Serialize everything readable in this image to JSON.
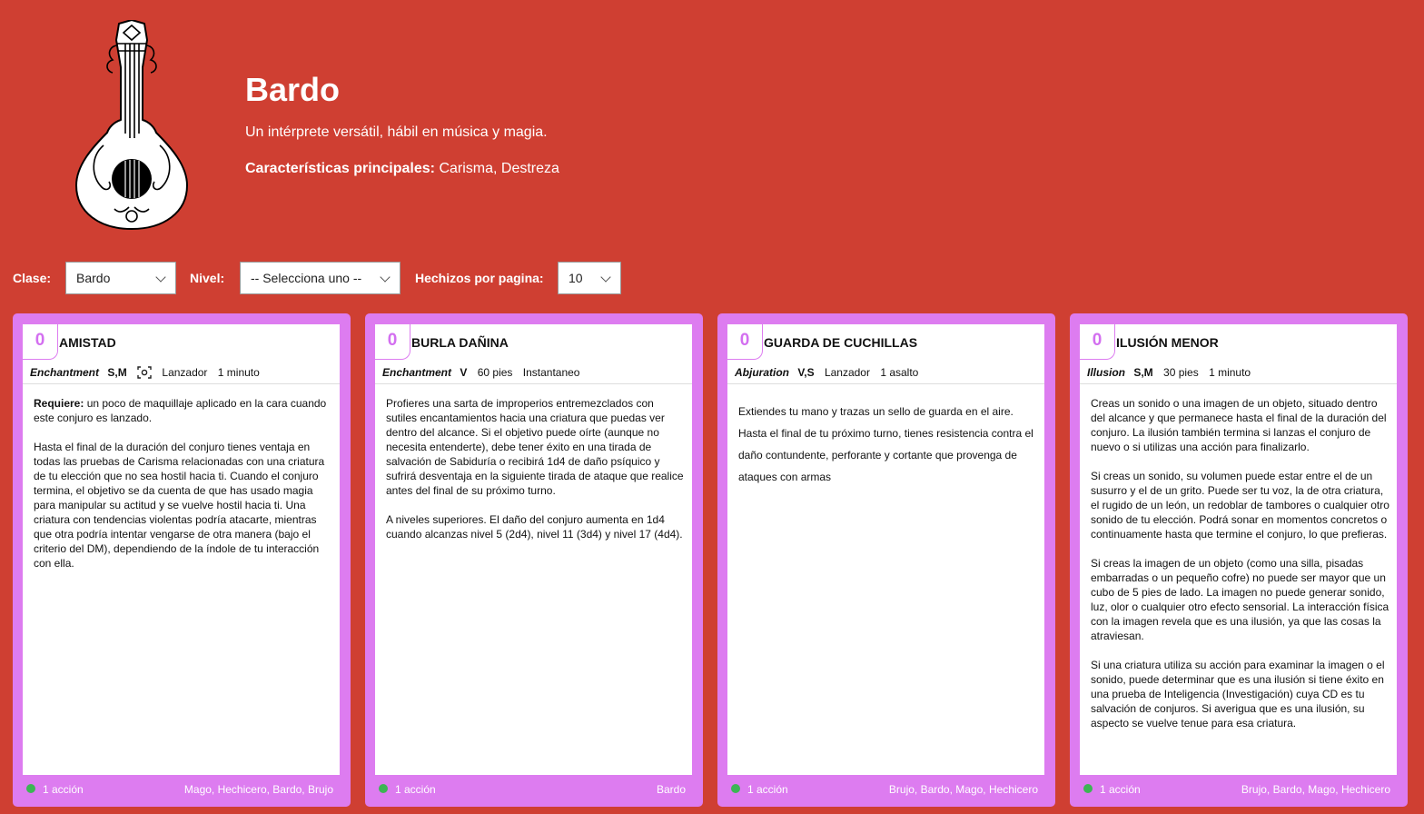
{
  "header": {
    "title": "Bardo",
    "description": "Un intérprete versátil, hábil en música y magia.",
    "main_label": "Características principales:",
    "main_value": "Carisma, Destreza"
  },
  "filters": {
    "class_label": "Clase:",
    "class_value": "Bardo",
    "level_label": "Nivel:",
    "level_value": "-- Selecciona uno --",
    "perpage_label": "Hechizos por pagina:",
    "perpage_value": "10"
  },
  "colors": {
    "background": "#cf3f32",
    "card": "#dd7cf0",
    "level": "#d36ff0",
    "cast_dot": "#3cb554"
  },
  "cards": [
    {
      "level": "0",
      "name": "AMISTAD",
      "school": "Enchantment",
      "components": "S,M",
      "range_icon": "self-target-icon",
      "range": "Lanzador",
      "duration": "1 minuto",
      "requires_label": "Requiere:",
      "requires_text": "un poco de maquillaje aplicado en la cara cuando este conjuro es lanzado.",
      "paragraphs": [
        "Hasta el final de la duración del conjuro tienes ventaja en todas las pruebas de Carisma relacionadas con una criatura de tu elección que no sea hostil hacia ti. Cuando el conjuro termina, el objetivo se da cuenta de que has usado magia para manipular su actitud y se vuelve hostil hacia ti. Una criatura con tendencias violentas podría atacarte, mientras que otra podría intentar vengarse de otra manera (bajo el criterio del DM), dependiendo de la índole de tu interacción con ella."
      ],
      "casting_time": "1 acción",
      "classes": "Mago, Hechicero, Bardo, Brujo"
    },
    {
      "level": "0",
      "name": "BURLA DAÑINA",
      "school": "Enchantment",
      "components": "V",
      "range": "60 pies",
      "duration": "Instantaneo",
      "paragraphs": [
        "Profieres una sarta de improperios entremezclados con sutiles encantamientos hacia una criatura que puedas ver dentro del alcance. Si el objetivo puede oírte (aunque no necesita entenderte), debe tener éxito en una tirada de salvación de Sabiduría o recibirá 1d4 de daño psíquico y sufrirá desventaja en la siguiente tirada de ataque que realice antes del final de su próximo turno.",
        "A niveles superiores. El daño del conjuro aumenta en 1d4 cuando alcanzas nivel 5 (2d4), nivel 11 (3d4) y nivel 17 (4d4)."
      ],
      "casting_time": "1 acción",
      "classes": "Bardo"
    },
    {
      "level": "0",
      "name": "GUARDA DE CUCHILLAS",
      "school": "Abjuration",
      "components": "V,S",
      "range": "Lanzador",
      "duration": "1 asalto",
      "paragraphs": [
        "Extiendes tu mano y trazas un sello de guarda en el aire.",
        "Hasta el final de tu próximo turno, tienes resistencia contra el daño contundente, perforante y cortante que provenga de ataques con armas"
      ],
      "casting_time": "1 acción",
      "classes": "Brujo, Bardo, Mago, Hechicero"
    },
    {
      "level": "0",
      "name": "ILUSIÓN MENOR",
      "school": "Illusion",
      "components": "S,M",
      "range": "30 pies",
      "duration": "1 minuto",
      "paragraphs": [
        "Creas un sonido o una imagen de un objeto, situado dentro del alcance y que permanece hasta el final de la duración del conjuro. La ilusión también termina si lanzas el conjuro de nuevo o si utilizas una acción para finalizarlo.",
        "Si creas un sonido, su volumen puede estar entre el de un susurro y el de un grito. Puede ser tu voz, la de otra criatura, el rugido de un león, un redoblar de tambores o cualquier otro sonido de tu elección. Podrá sonar en momentos concretos o continuamente hasta que termine el conjuro, lo que prefieras.",
        "Si creas la imagen de un objeto (como una silla, pisadas embarradas o un pequeño cofre) no puede ser mayor que un cubo de 5 pies de lado. La imagen no puede generar sonido, luz, olor o cualquier otro efecto sensorial. La interacción física con la imagen revela que es una ilusión, ya que las cosas la atraviesan.",
        "Si una criatura utiliza su acción para examinar la imagen o el sonido, puede determinar que es una ilusión si tiene éxito en una prueba de Inteligencia (Investigación) cuya CD es tu salvación de conjuros. Si averigua que es una ilusión, su aspecto se vuelve tenue para esa criatura."
      ],
      "casting_time": "1 acción",
      "classes": "Brujo, Bardo, Mago, Hechicero"
    }
  ]
}
